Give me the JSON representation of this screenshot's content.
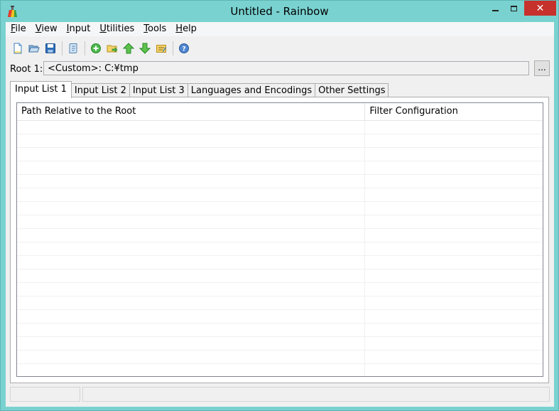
{
  "window": {
    "title": "Untitled - Rainbow",
    "minimize_glyph": "",
    "close_glyph": "✕"
  },
  "menu": [
    {
      "mnemonic": "F",
      "rest": "ile"
    },
    {
      "mnemonic": "V",
      "rest": "iew"
    },
    {
      "mnemonic": "I",
      "rest": "nput"
    },
    {
      "mnemonic": "U",
      "rest": "tilities"
    },
    {
      "mnemonic": "T",
      "rest": "ools"
    },
    {
      "mnemonic": "H",
      "rest": "elp"
    }
  ],
  "toolbar": {
    "icons": [
      "new-file-icon",
      "open-folder-icon",
      "save-icon",
      "script-icon",
      "add-icon",
      "folder-move-icon",
      "move-up-icon",
      "move-down-icon",
      "edit-icon",
      "help-icon"
    ]
  },
  "root": {
    "label": "Root 1:",
    "value": "<Custom>:  C:¥tmp",
    "browse_label": "..."
  },
  "tabs": [
    "Input List 1",
    "Input List 2",
    "Input List 3",
    "Languages and Encodings",
    "Other Settings"
  ],
  "list": {
    "columns": [
      "Path Relative to the Root",
      "Filter Configuration"
    ],
    "rows": []
  },
  "colors": {
    "frame": "#79d2d0",
    "close_button": "#c7312b"
  }
}
